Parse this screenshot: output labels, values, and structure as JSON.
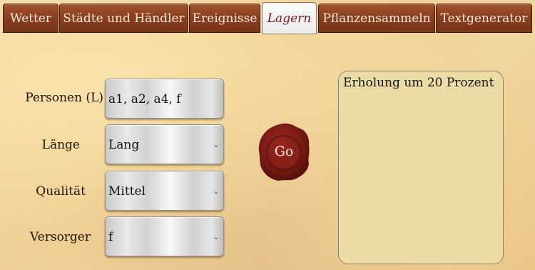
{
  "tabs": [
    {
      "label": "Wetter",
      "active": false
    },
    {
      "label": "Städte und Händler",
      "active": false
    },
    {
      "label": "Ereignisse",
      "active": false
    },
    {
      "label": "Lagern",
      "active": true
    },
    {
      "label": "Pflanzensammeln",
      "active": false
    },
    {
      "label": "Textgenerator",
      "active": false
    }
  ],
  "form": {
    "personen": {
      "label": "Personen (L)",
      "value": "a1, a2, a4, f"
    },
    "laenge": {
      "label": "Länge",
      "value": "Lang"
    },
    "qualitaet": {
      "label": "Qualität",
      "value": "Mittel"
    },
    "versorger": {
      "label": "Versorger",
      "value": "f"
    }
  },
  "go_button": {
    "label": "Go",
    "color": "#7e1d16"
  },
  "output": {
    "text": "Erholung um 20 Prozent"
  },
  "colors": {
    "tab_bg": "#8a3f20",
    "active_tab_text": "#7a1414",
    "output_bg": "#ebdba4"
  }
}
